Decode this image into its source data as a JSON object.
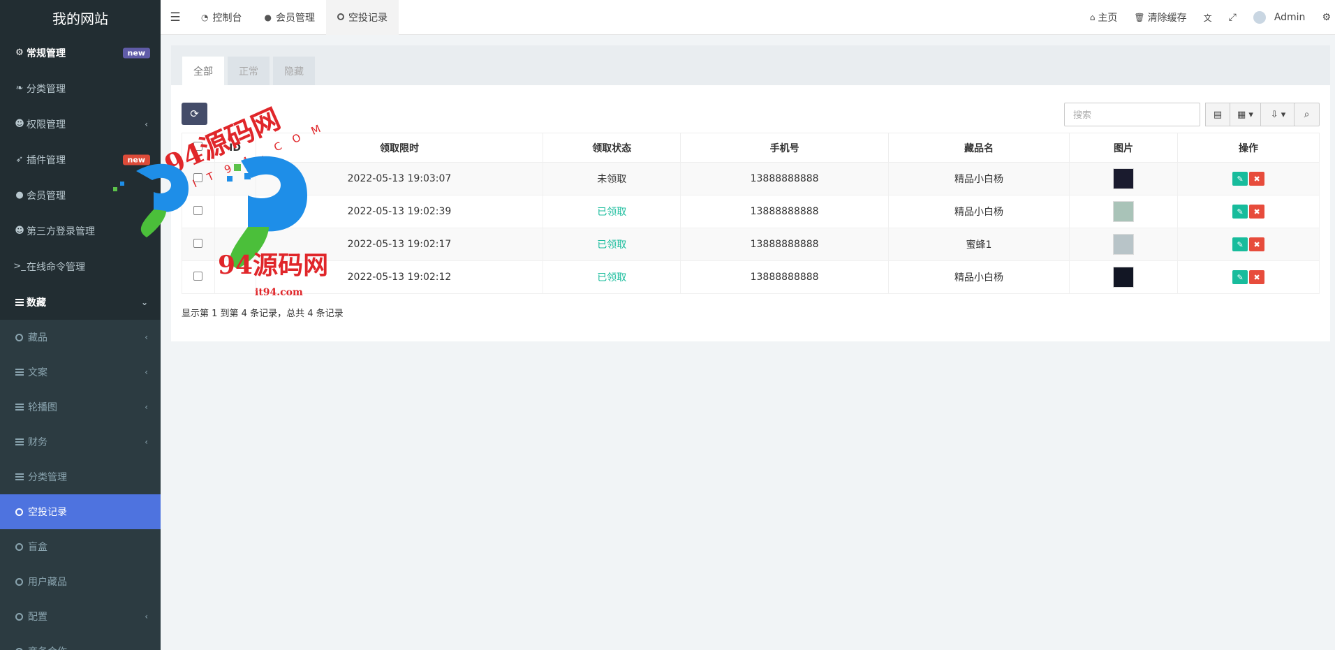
{
  "brand": "我的网站",
  "sidebar": {
    "items": [
      {
        "label": "常规管理",
        "icon": "cogs-icon",
        "badge": "new",
        "badge_color": "#605ca8"
      },
      {
        "label": "分类管理",
        "icon": "leaf-icon"
      },
      {
        "label": "权限管理",
        "icon": "group-icon",
        "chevron": "‹"
      },
      {
        "label": "插件管理",
        "icon": "rocket-icon",
        "badge": "new",
        "badge_color": "#dd4b39"
      },
      {
        "label": "会员管理",
        "icon": "user-circle-icon"
      },
      {
        "label": "第三方登录管理",
        "icon": "users-icon"
      },
      {
        "label": "在线命令管理",
        "icon": "terminal-icon"
      },
      {
        "label": "数藏",
        "icon": "list-icon",
        "chevron": "⌄"
      }
    ],
    "subitems": [
      {
        "label": "藏品",
        "icon": "circle-icon",
        "chevron": "‹"
      },
      {
        "label": "文案",
        "icon": "list-icon",
        "chevron": "‹"
      },
      {
        "label": "轮播图",
        "icon": "list-icon",
        "chevron": "‹"
      },
      {
        "label": "财务",
        "icon": "list-icon",
        "chevron": "‹"
      },
      {
        "label": "分类管理",
        "icon": "list-icon"
      },
      {
        "label": "空投记录",
        "icon": "circle-icon",
        "active": true
      },
      {
        "label": "盲盒",
        "icon": "circle-icon"
      },
      {
        "label": "用户藏品",
        "icon": "circle-icon"
      },
      {
        "label": "配置",
        "icon": "circle-icon",
        "chevron": "‹"
      },
      {
        "label": "商务合作",
        "icon": "circle-icon"
      }
    ]
  },
  "topbar": {
    "tabs": [
      {
        "label": "控制台",
        "icon": "dashboard-icon"
      },
      {
        "label": "会员管理",
        "icon": "user-icon"
      },
      {
        "label": "空投记录",
        "icon": "circle-icon"
      }
    ],
    "right": {
      "home": "主页",
      "clear_cache": "清除缓存",
      "user": "Admin"
    }
  },
  "panel": {
    "tabs": [
      "全部",
      "正常",
      "隐藏"
    ],
    "search_placeholder": "搜索",
    "columns": [
      "ID",
      "领取限时",
      "领取状态",
      "手机号",
      "藏品名",
      "图片",
      "操作"
    ],
    "rows": [
      {
        "id": "",
        "time": "2022-05-13 19:03:07",
        "status": "未领取",
        "status_color": "#333333",
        "phone": "13888888888",
        "name": "精品小白杨",
        "thumb": "#1a1b2e"
      },
      {
        "id": "",
        "time": "2022-05-13 19:02:39",
        "status": "已领取",
        "status_color": "#18bc9c",
        "phone": "13888888888",
        "name": "精品小白杨",
        "thumb": "#a9c3b8"
      },
      {
        "id": "",
        "time": "2022-05-13 19:02:17",
        "status": "已领取",
        "status_color": "#18bc9c",
        "phone": "13888888888",
        "name": "蜜蜂1",
        "thumb": "#b8c4c8"
      },
      {
        "id": "",
        "time": "2022-05-13 19:02:12",
        "status": "已领取",
        "status_color": "#18bc9c",
        "phone": "13888888888",
        "name": "精品小白杨",
        "thumb": "#121624"
      }
    ],
    "footer": "显示第 1 到第 4 条记录，总共 4 条记录"
  },
  "watermark": {
    "text1": "94源码网",
    "text2": "IT94.COM",
    "text3": "94源码网",
    "text4": "it94.com"
  }
}
